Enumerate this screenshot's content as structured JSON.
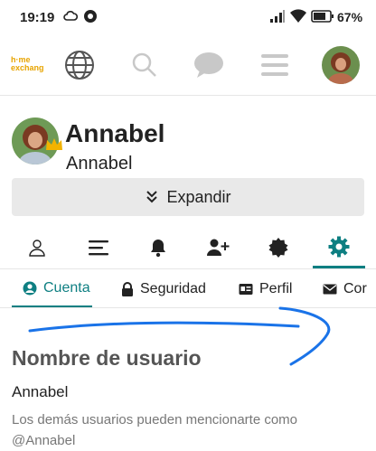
{
  "status_bar": {
    "time": "19:19",
    "battery": "67%"
  },
  "app_bar": {
    "logo_line1": "h·me",
    "logo_line2": "exchang",
    "icons": [
      "globe-icon",
      "search-icon",
      "chat-icon",
      "menu-icon",
      "avatar"
    ]
  },
  "profile": {
    "display_name": "Annabel",
    "username": "Annabel",
    "expand_label": "Expandir"
  },
  "icon_tabs": [
    "user-icon",
    "list-icon",
    "bell-icon",
    "add-user-icon",
    "badge-icon",
    "gear-icon"
  ],
  "active_icon_tab": "gear-icon",
  "text_tabs": [
    {
      "label": "Cuenta",
      "icon": "account-circle-icon",
      "active": true
    },
    {
      "label": "Seguridad",
      "icon": "lock-icon",
      "active": false
    },
    {
      "label": "Perfil",
      "icon": "id-card-icon",
      "active": false
    },
    {
      "label": "Cor",
      "icon": "mail-icon",
      "active": false
    }
  ],
  "section": {
    "title": "Nombre de usuario",
    "value": "Annabel",
    "help_line1": "Los demás usuarios pueden mencionarte como",
    "help_line2": "@Annabel"
  },
  "colors": {
    "accent": "#0e7f82",
    "logo": "#e8a400",
    "annotation": "#1a73e8"
  }
}
